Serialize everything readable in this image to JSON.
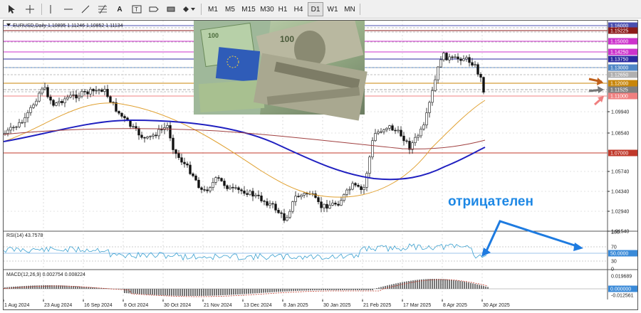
{
  "toolbar": {
    "timeframes": [
      "M1",
      "M5",
      "M15",
      "M30",
      "H1",
      "H4",
      "D1",
      "W1",
      "MN"
    ],
    "active_timeframe": "D1"
  },
  "main_panel": {
    "header": "EURUSD,Daily  1.10895 1.11246 1.10852 1.11134",
    "annotation": "отрицателен"
  },
  "price_axis": [
    {
      "label": "1.16000",
      "bg": "#4a4fb0"
    },
    {
      "label": "1.15225",
      "bg": "#8b1a1a"
    },
    {
      "label": "1.15000",
      "bg": "#cc33cc"
    },
    {
      "label": "1.14250",
      "bg": "#cc33cc"
    },
    {
      "label": "1.13750",
      "bg": "#2a2aa0"
    },
    {
      "label": "1.13000",
      "bg": "#4f86c6"
    },
    {
      "label": "1.12650",
      "bg": "#b0b0b0"
    },
    {
      "label": "1.12000",
      "bg": "#c8860a"
    },
    {
      "label": "1.11525",
      "bg": "#7f7f7f"
    },
    {
      "label": "1.11000",
      "bg": "#f08080"
    },
    {
      "label": "1.09940",
      "bg": ""
    },
    {
      "label": "1.08540",
      "bg": ""
    },
    {
      "label": "1.07000",
      "bg": "#c0392b"
    },
    {
      "label": "1.05740",
      "bg": ""
    },
    {
      "label": "1.04340",
      "bg": ""
    },
    {
      "label": "1.02940",
      "bg": ""
    },
    {
      "label": "1.01540",
      "bg": ""
    }
  ],
  "rsi_panel": {
    "header": "RSI(14) 43.7578",
    "axis": [
      "100",
      "70",
      "50.0000",
      "30",
      "0"
    ]
  },
  "macd_panel": {
    "header": "MACD(12,26,9) 0.002754 0.008224",
    "axis": [
      "0.019689",
      "0.000000",
      "-0.012561"
    ]
  },
  "date_axis": [
    "1 Aug 2024",
    "23 Aug 2024",
    "16 Sep 2024",
    "8 Oct 2024",
    "30 Oct 2024",
    "21 Nov 2024",
    "13 Dec 2024",
    "8 Jan 2025",
    "30 Jan 2025",
    "21 Feb 2025",
    "17 Mar 2025",
    "8 Apr 2025",
    "30 Apr 2025"
  ],
  "colors": {
    "ma_fast": "#e0a030",
    "ma_mid": "#2020c0",
    "ma_slow": "#a04040",
    "rsi_line": "#3aa0d0",
    "arrow_blue": "#1e7be0"
  }
}
